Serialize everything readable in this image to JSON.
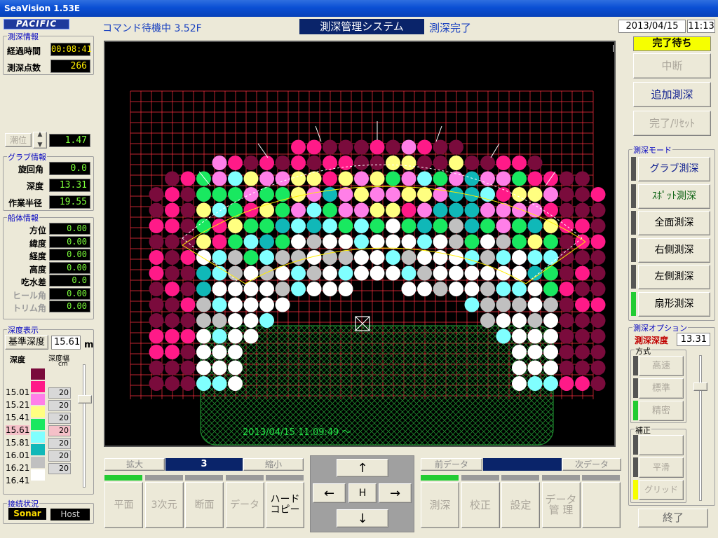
{
  "app": {
    "title": "SeaVision 1.53E",
    "logo": "PACIFIC"
  },
  "header": {
    "command_status": "コマンド待機中 3.52F",
    "system_title": "測深管理システム",
    "survey_status": "測深完了",
    "date": "2013/04/15",
    "time": "11:13"
  },
  "survey_info": {
    "title": "測深情報",
    "elapsed_label": "経過時間",
    "elapsed": "00:08:41",
    "points_label": "測深点数",
    "points": "266"
  },
  "tide": {
    "label": "潮位",
    "value": "1.47"
  },
  "grab_info": {
    "title": "グラブ情報",
    "rotation_label": "旋回角",
    "rotation": "0.0",
    "depth_label": "深度",
    "depth": "13.31",
    "radius_label": "作業半径",
    "radius": "19.55"
  },
  "ship_info": {
    "title": "船体情報",
    "rows": [
      {
        "label": "方位",
        "value": "0.00",
        "disabled": false
      },
      {
        "label": "緯度",
        "value": "0.00",
        "disabled": false
      },
      {
        "label": "経度",
        "value": "0.00",
        "disabled": false
      },
      {
        "label": "高度",
        "value": "0.00",
        "disabled": false
      },
      {
        "label": "吃水差",
        "value": "0.0",
        "disabled": false
      },
      {
        "label": "ヒール角",
        "value": "0.00",
        "disabled": true
      },
      {
        "label": "トリム角",
        "value": "0.00",
        "disabled": true
      }
    ]
  },
  "depth_display": {
    "title": "深度表示",
    "base_label": "基準深度",
    "base_value": "15.61",
    "unit": "m",
    "col_depth": "深度",
    "col_width": "深度幅",
    "col_unit": "cm",
    "rows": [
      {
        "depth": "",
        "color": "#7a0b3c",
        "width": ""
      },
      {
        "depth": "15.01",
        "color": "#ff1a88",
        "width": "20"
      },
      {
        "depth": "15.21",
        "color": "#ff7fe8",
        "width": "20"
      },
      {
        "depth": "15.41",
        "color": "#ffff80",
        "width": "20"
      },
      {
        "depth": "15.61",
        "color": "#19e860",
        "width": "20",
        "highlight": true
      },
      {
        "depth": "15.81",
        "color": "#80ffff",
        "width": "20"
      },
      {
        "depth": "16.01",
        "color": "#10b8b8",
        "width": "20"
      },
      {
        "depth": "16.21",
        "color": "#c0c0c0",
        "width": "20"
      },
      {
        "depth": "16.41",
        "color": "#ffffff",
        "width": ""
      }
    ]
  },
  "connection": {
    "title": "接続状況",
    "sonar": "Sonar",
    "host": "Host"
  },
  "plot": {
    "timestamp": "2013/04/15 11:09:49 ～"
  },
  "zoom": {
    "in_label": "拡大",
    "level": "3",
    "out_label": "縮小"
  },
  "bottom_left_buttons": [
    "平面",
    "3次元",
    "断面",
    "データ",
    "ハード\nコピー"
  ],
  "arrows": {
    "up": "↑",
    "left": "←",
    "home": "H",
    "right": "→",
    "down": "↓"
  },
  "data_nav": {
    "prev_label": "前データ",
    "next_label": "次データ"
  },
  "bottom_right_buttons": [
    "測深",
    "校正",
    "設定",
    "データ\n管 理",
    ""
  ],
  "right_panel": {
    "status": "完了待ち",
    "pause": "中断",
    "add_survey": "追加測深",
    "complete_reset": "完了/ﾘｾｯﾄ",
    "mode_title": "測深モード",
    "modes": [
      {
        "label": "グラブ測深",
        "state": "on"
      },
      {
        "label": "ｽﾎﾟｯﾄ測深",
        "state": "green"
      },
      {
        "label": "全面測深",
        "state": "plain"
      },
      {
        "label": "右側測深",
        "state": "plain"
      },
      {
        "label": "左側測深",
        "state": "plain"
      },
      {
        "label": "扇形測深",
        "state": "plain"
      }
    ],
    "option_title": "測深オプション",
    "survey_depth_label": "測深深度",
    "survey_depth": "13.31",
    "method_title": "方式",
    "methods": [
      "高速",
      "標準",
      "精密"
    ],
    "correction_title": "補正",
    "corrections": [
      "",
      "平滑",
      "グリッド"
    ],
    "exit": "終了"
  },
  "colors": {
    "accent": "#0a246a",
    "value_text": "#7cff3a",
    "grid": "#ff3040"
  }
}
